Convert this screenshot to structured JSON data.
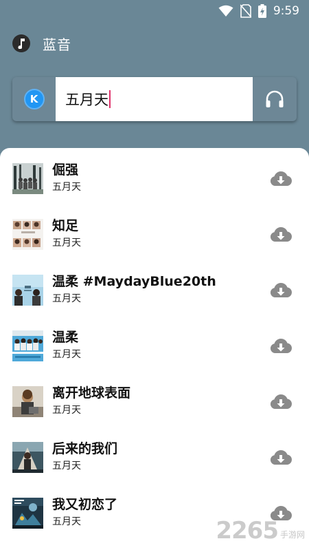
{
  "status_bar": {
    "time": "9:59",
    "icons": [
      "wifi-icon",
      "no-sim-icon",
      "battery-charging-icon"
    ]
  },
  "app": {
    "logo_icon": "music-note-icon",
    "title": "蓝音"
  },
  "search": {
    "source_label": "K",
    "value": "五月天",
    "listen_icon": "headphones-icon"
  },
  "results": [
    {
      "title": "倔强",
      "artist": "五月天",
      "cover": "cover-1",
      "action_icon": "cloud-download-icon"
    },
    {
      "title": "知足",
      "artist": "五月天",
      "cover": "cover-2",
      "action_icon": "cloud-download-icon"
    },
    {
      "title": "温柔 #MaydayBlue20th",
      "artist": "五月天",
      "cover": "cover-3",
      "action_icon": "cloud-download-icon"
    },
    {
      "title": "温柔",
      "artist": "五月天",
      "cover": "cover-4",
      "action_icon": "cloud-download-icon"
    },
    {
      "title": "离开地球表面",
      "artist": "五月天",
      "cover": "cover-5",
      "action_icon": "cloud-download-icon"
    },
    {
      "title": "后来的我们",
      "artist": "五月天",
      "cover": "cover-6",
      "action_icon": "cloud-download-icon"
    },
    {
      "title": "我又初恋了",
      "artist": "五月天",
      "cover": "cover-7",
      "action_icon": "cloud-download-icon"
    }
  ],
  "watermark": {
    "number": "2265",
    "suffix": "手游网"
  },
  "colors": {
    "header_bg": "#6a8796",
    "accent_caret": "#e0326b",
    "source_badge": "#2196f3",
    "download_icon": "#8a8a8a"
  }
}
